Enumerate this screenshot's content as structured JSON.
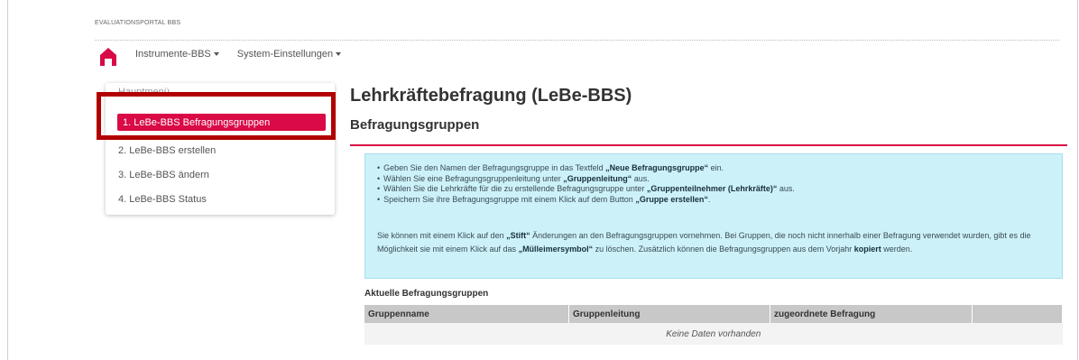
{
  "brand": "EVALUATIONSPORTAL BBS",
  "nav": [
    {
      "label": "Instrumente-BBS"
    },
    {
      "label": "System-Einstellungen"
    }
  ],
  "sidebar": {
    "header": "Hauptmenü",
    "items": [
      {
        "label": "1. LeBe-BBS Befragungsgruppen"
      },
      {
        "label": "2. LeBe-BBS erstellen"
      },
      {
        "label": "3. LeBe-BBS ändern"
      },
      {
        "label": "4. LeBe-BBS Status"
      }
    ]
  },
  "main": {
    "title": "Lehrkräftebefragung (LeBe-BBS)",
    "subtitle": "Befragungsgruppen"
  },
  "info": {
    "b1_pre": "Geben Sie den Namen der Befragungsgruppe in das Textfeld ",
    "b1_bold": "„Neue Befragungsgruppe“",
    "b1_post": " ein.",
    "b2_pre": "Wählen Sie eine Befragungsgruppenleitung unter ",
    "b2_bold": "„Gruppenleitung“",
    "b2_post": " aus.",
    "b3_pre": "Wählen Sie die Lehrkräfte für die zu erstellende Befragungsgruppe unter ",
    "b3_bold": "„Gruppenteilnehmer (Lehrkräfte)“",
    "b3_post": " aus.",
    "b4_pre": "Speichern Sie ihre Befragungsgruppe mit einem Klick auf dem Button ",
    "b4_bold": "„Gruppe erstellen“",
    "b4_post": ".",
    "p_a": "Sie können mit einem Klick auf den ",
    "p_b": "„Stift“",
    "p_c": " Änderungen an den Befragungsgruppen vornehmen. Bei Gruppen, die noch nicht innerhalb einer Befragung verwendet wurden, gibt es die Möglichkeit sie mit einem Klick auf das ",
    "p_d": "„Mülleimersymbol“",
    "p_e": " zu löschen. Zusätzlich können die Befragungsgruppen aus dem Vorjahr ",
    "p_f": "kopiert",
    "p_g": " werden."
  },
  "table": {
    "title": "Aktuelle Befragungsgruppen",
    "columns": [
      "Gruppenname",
      "Gruppenleitung",
      "zugeordnete Befragung",
      ""
    ],
    "empty": "Keine Daten vorhanden"
  },
  "colors": {
    "accent": "#d90a46",
    "highlight": "#b20000",
    "info_bg": "#ccf1f9"
  }
}
